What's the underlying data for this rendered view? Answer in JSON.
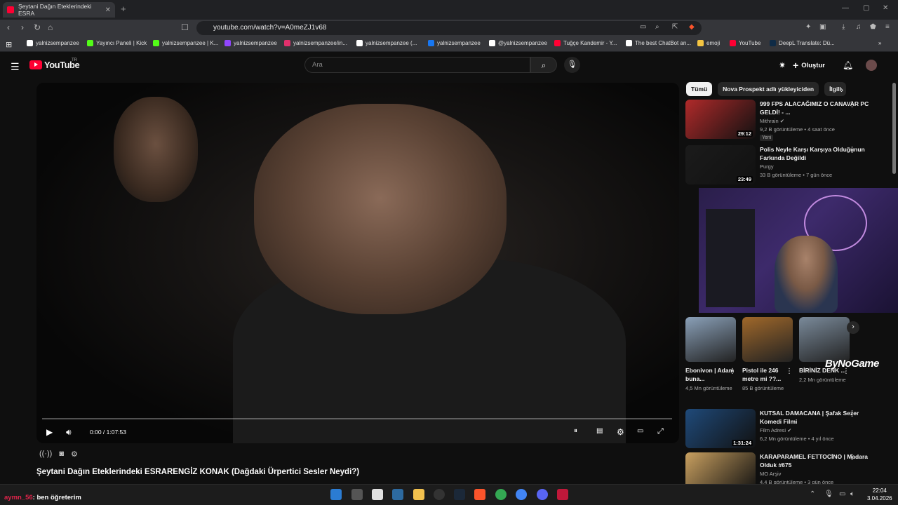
{
  "browser": {
    "tab_title": "Şeytani Dağın Eteklerindeki ESRA",
    "url": "youtube.com/watch?v=A0meZJ1v68",
    "bookmarks": [
      {
        "label": "yalnizsempanzee",
        "color": "#ffffff"
      },
      {
        "label": "Yayıncı Paneli | Kick",
        "color": "#53fc18"
      },
      {
        "label": "yalnizsempanzee | K...",
        "color": "#53fc18"
      },
      {
        "label": "yalnizsempanzee",
        "color": "#9146ff"
      },
      {
        "label": "yalnizsempanzee/in...",
        "color": "#e1306c"
      },
      {
        "label": "yalnizsempanzee (...",
        "color": "#ffffff"
      },
      {
        "label": "yalnizsempanzee",
        "color": "#1877f2"
      },
      {
        "label": "@yalnizsempanzee",
        "color": "#ffffff"
      },
      {
        "label": "Tuğçe Kandemir - Y...",
        "color": "#ff0033"
      },
      {
        "label": "The best ChatBot an...",
        "color": "#ffffff"
      },
      {
        "label": "emoji",
        "color": "#f5c542"
      },
      {
        "label": "YouTube",
        "color": "#ff0033"
      },
      {
        "label": "DeepL Translate: Dü...",
        "color": "#0f2b46"
      }
    ]
  },
  "youtube": {
    "logo": "YouTube",
    "region": "TR",
    "search_placeholder": "Ara",
    "create_label": "Oluştur"
  },
  "player": {
    "time": "0:00 / 1:07:53"
  },
  "video": {
    "title": "Şeytani Dağın Eteklerindeki ESRARENGİZ KONAK (Dağdaki Ürpertici Sesler Neydi?)"
  },
  "chips": [
    {
      "label": "Tümü",
      "active": true
    },
    {
      "label": "Nova Prospekt adlı yükleyiciden",
      "active": false
    },
    {
      "label": "İlgili",
      "active": false
    }
  ],
  "recs": [
    {
      "title": "999 FPS ALACAĞIMIZ O CANAVAR PC GELDİ! - ...",
      "channel": "Mithrain ✔",
      "meta": "9,2 B görüntüleme • 4 saat önce",
      "badge": "Yeni",
      "duration": "29:12",
      "color": "#b02a2a"
    },
    {
      "title": "Polis Neyle Karşı Karşıya Olduğunun Farkında Değildi",
      "channel": "Purgy",
      "meta": "33 B görüntüleme • 7 gün önce",
      "badge": "",
      "duration": "23:49",
      "color": "#1b1b1b"
    },
    {
      "title": "KUTSAL DAMACANA | Şafak Sezer Komedi Filmi",
      "channel": "Film Adresi ✔",
      "meta": "6,2 Mn görüntüleme • 4 yıl önce",
      "badge": "",
      "duration": "1:31:24",
      "color": "#1f4a7a"
    },
    {
      "title": "KARAPARAMEL FETTOCİNO | Madara Olduk #675",
      "channel": "MO Arşiv",
      "meta": "4,4 B görüntüleme • 3 gün önce",
      "badge": "",
      "duration": "",
      "color": "#c9a060"
    }
  ],
  "shorts": [
    {
      "title": "Ebonivon | Adam buna...",
      "views": "4,5 Mn görüntüleme",
      "color": "#8aa0b8"
    },
    {
      "title": "Pistol ile 246 metre mi ??...",
      "views": "85 B görüntüleme",
      "color": "#a0682a"
    },
    {
      "title": "BİRİNİZ DENK ...",
      "views": "2,2 Mn görüntüleme",
      "color": "#7a8a9a"
    }
  ],
  "overlay": {
    "brand": "ByNoGame"
  },
  "chat": {
    "user": "aymn_56",
    "message": ": ben öğreterim"
  },
  "clock": {
    "time": "22:04",
    "date": "3.04.2026"
  }
}
